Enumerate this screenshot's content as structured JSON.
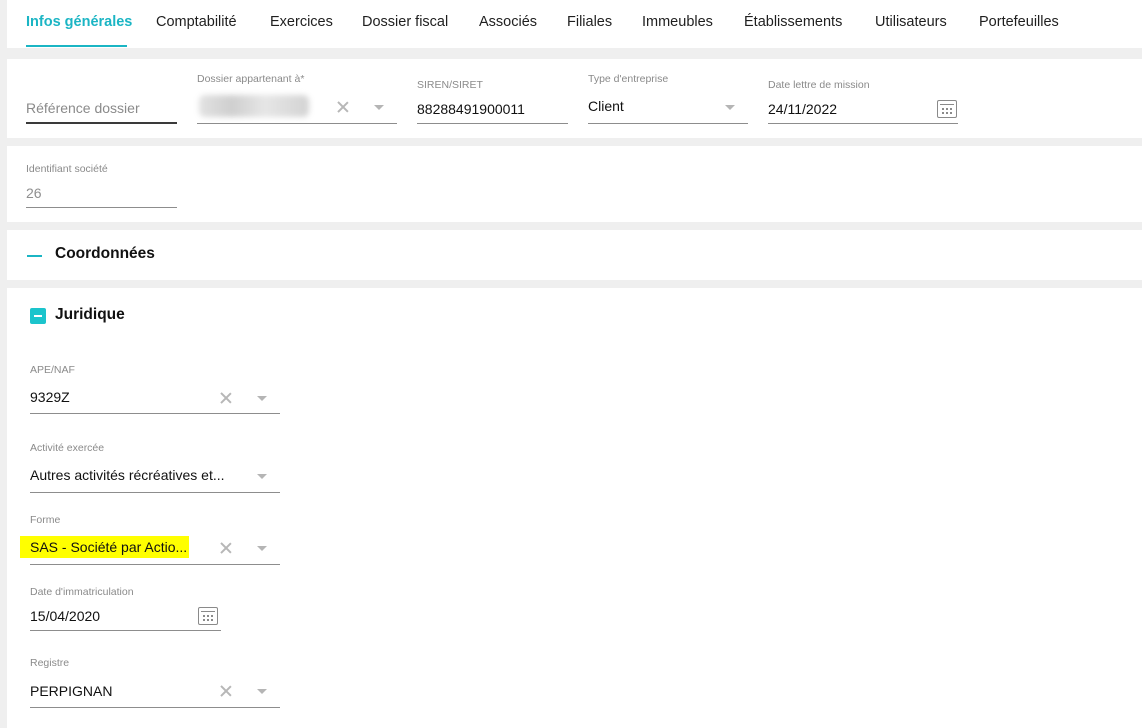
{
  "tabs": [
    {
      "label": "Infos générales",
      "active": true
    },
    {
      "label": "Comptabilité",
      "active": false
    },
    {
      "label": "Exercices",
      "active": false
    },
    {
      "label": "Dossier fiscal",
      "active": false
    },
    {
      "label": "Associés",
      "active": false
    },
    {
      "label": "Filiales",
      "active": false
    },
    {
      "label": "Immeubles",
      "active": false
    },
    {
      "label": "Établissements",
      "active": false
    },
    {
      "label": "Utilisateurs",
      "active": false
    },
    {
      "label": "Portefeuilles",
      "active": false
    }
  ],
  "general": {
    "reference": {
      "placeholder": "Référence dossier",
      "value": ""
    },
    "owner": {
      "label": "Dossier appartenant à*",
      "value_redacted": true
    },
    "siren": {
      "label": "SIREN/SIRET",
      "value": "88288491900011"
    },
    "company_type": {
      "label": "Type d'entreprise",
      "value": "Client"
    },
    "mission_date": {
      "label": "Date lettre de mission",
      "value": "24/11/2022"
    },
    "company_id": {
      "label": "Identifiant société",
      "value": "26"
    }
  },
  "sections": {
    "coordonnees": {
      "title": "Coordonnées"
    },
    "juridique": {
      "title": "Juridique"
    }
  },
  "juridique": {
    "ape": {
      "label": "APE/NAF",
      "value": "9329Z"
    },
    "activite": {
      "label": "Activité exercée",
      "value": "Autres activités récréatives et..."
    },
    "forme": {
      "label": "Forme",
      "value": "SAS - Société par Actio...",
      "highlight_color": "#ffff00"
    },
    "immatriculation": {
      "label": "Date d'immatriculation",
      "value": "15/04/2020"
    },
    "registre": {
      "label": "Registre",
      "value": "PERPIGNAN"
    }
  },
  "colors": {
    "accent": "#1bb5c4",
    "background": "#efefef"
  },
  "icons": [
    "clear-icon",
    "chevron-down-icon",
    "calendar-icon",
    "collapse-dash-icon",
    "minus-box-icon"
  ]
}
